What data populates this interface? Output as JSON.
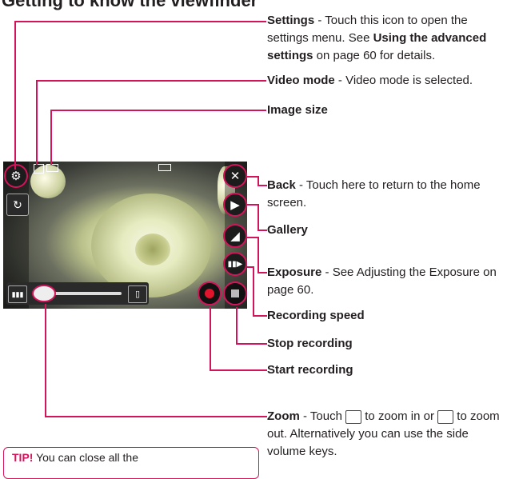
{
  "page": {
    "title": "Getting to know the viewfinder"
  },
  "annotations": {
    "settings": {
      "label": "Settings",
      "text": " - Touch this icon to open the settings menu. See ",
      "link": "Using the advanced settings",
      "tail": " on page 60 for details."
    },
    "video_mode": {
      "label": "Video mode",
      "text": " - Video mode is selected."
    },
    "image_size": {
      "label": "Image size"
    },
    "back": {
      "label": "Back",
      "text": " - Touch here to return to the home screen."
    },
    "gallery": {
      "label": "Gallery"
    },
    "exposure": {
      "label": "Exposure",
      "text": " - See Adjusting the Exposure on page 60."
    },
    "recording_speed": {
      "label": "Recording speed"
    },
    "stop_recording": {
      "label": "Stop recording"
    },
    "start_recording": {
      "label": "Start recording"
    },
    "zoom": {
      "label": "Zoom",
      "text1": " - Touch ",
      "text2": " to zoom in or ",
      "text3": " to zoom out. Alternatively you can use the side volume keys."
    }
  },
  "tip": {
    "label": "TIP!",
    "text": " You can close all the"
  },
  "colors": {
    "accent": "#d4145a",
    "text": "#231f20"
  },
  "icons": {
    "settings": "gear-icon",
    "video_mode": "video-camera-icon",
    "image_size": "image-size-icon",
    "back": "close-icon",
    "gallery": "gallery-icon",
    "exposure": "exposure-icon",
    "recording_speed": "recording-speed-icon",
    "stop": "stop-icon",
    "record": "record-icon",
    "zoom_out": "zoom-out-icon",
    "zoom_in": "zoom-in-icon",
    "camera_swap": "camera-swap-icon",
    "battery": "battery-icon"
  }
}
